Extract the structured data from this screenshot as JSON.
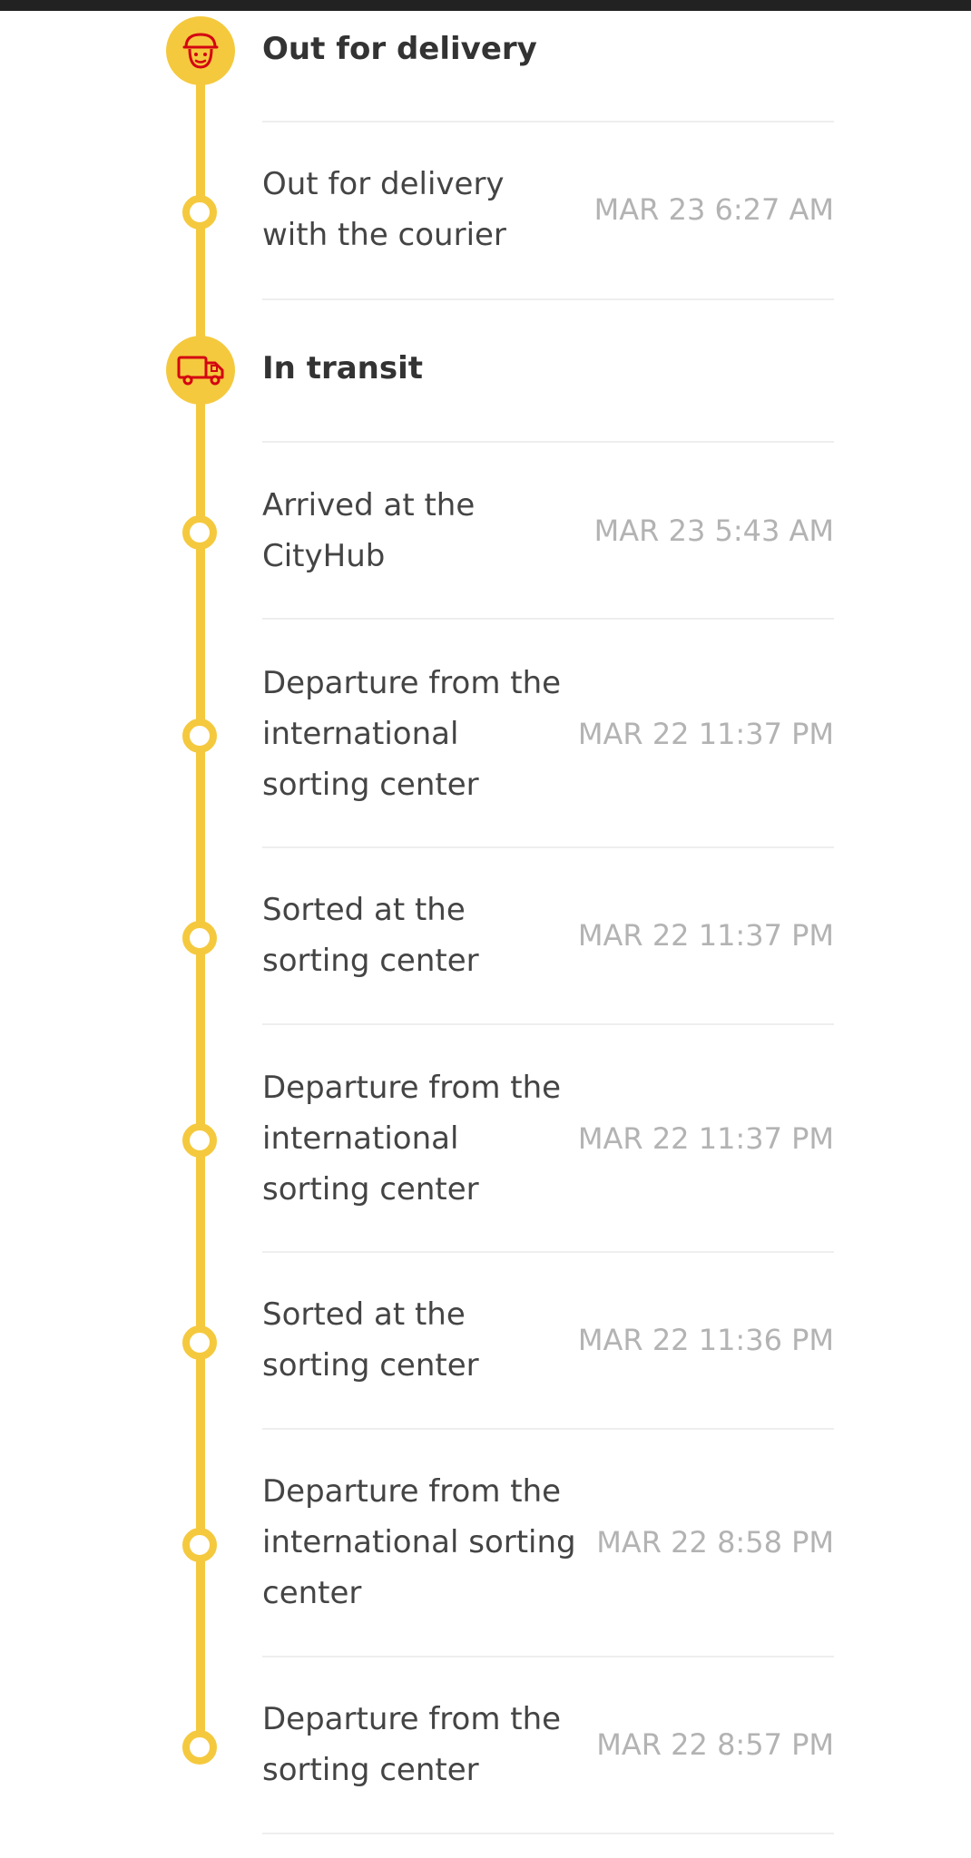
{
  "sections": [
    {
      "title": "Out for delivery",
      "icon": "courier-icon",
      "events": [
        {
          "text": "Out for delivery with the courier",
          "time": "MAR 23 6:27 AM"
        }
      ]
    },
    {
      "title": "In transit",
      "icon": "truck-icon",
      "events": [
        {
          "text": "Arrived at the CityHub",
          "time": "MAR 23 5:43 AM"
        },
        {
          "text": "Departure from the international sorting center",
          "time": "MAR 22 11:37 PM"
        },
        {
          "text": "Sorted at the sorting center",
          "time": "MAR 22 11:37 PM"
        },
        {
          "text": "Departure from the international sorting center",
          "time": "MAR 22 11:37 PM"
        },
        {
          "text": "Sorted at the sorting center",
          "time": "MAR 22 11:36 PM"
        },
        {
          "text": "Departure from the international sorting center",
          "time": "MAR 22 8:58 PM"
        },
        {
          "text": "Departure from the sorting center",
          "time": "MAR 22 8:57 PM"
        }
      ]
    }
  ],
  "colors": {
    "accent": "#f5c93e",
    "icon_red": "#d40511",
    "title": "#333333",
    "text": "#444444",
    "time": "#b3b3b3",
    "divider": "#eeeeee"
  }
}
